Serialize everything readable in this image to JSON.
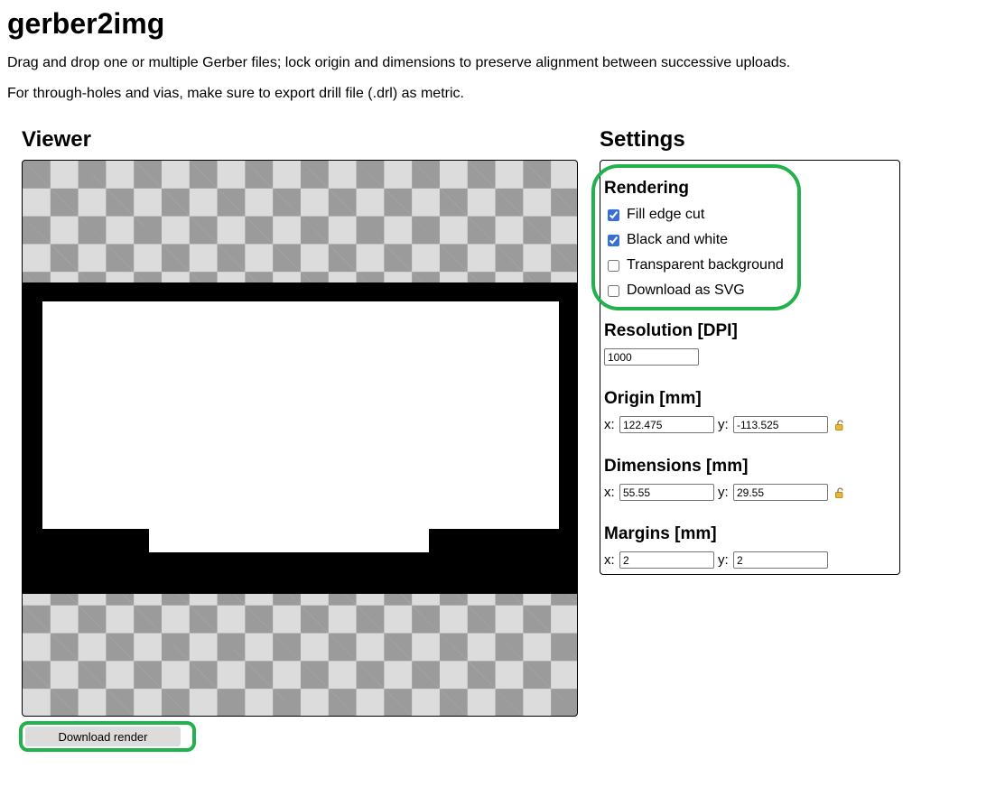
{
  "app": {
    "title": "gerber2img",
    "intro_1": "Drag and drop one or multiple Gerber files; lock origin and dimensions to preserve alignment between successive uploads.",
    "intro_2": "For through-holes and vias, make sure to export drill file (.drl) as metric."
  },
  "viewer": {
    "title": "Viewer",
    "download_label": "Download render"
  },
  "settings": {
    "title": "Settings",
    "rendering": {
      "title": "Rendering",
      "options": [
        {
          "label": "Fill edge cut",
          "checked": true
        },
        {
          "label": "Black and white",
          "checked": true
        },
        {
          "label": "Transparent background",
          "checked": false
        },
        {
          "label": "Download as SVG",
          "checked": false
        }
      ]
    },
    "resolution": {
      "title": "Resolution [DPI]",
      "value": "1000"
    },
    "origin": {
      "title": "Origin [mm]",
      "x_label": "x:",
      "x": "122.475",
      "y_label": "y:",
      "y": "-113.525",
      "lock_icon": "lock-icon"
    },
    "dimensions": {
      "title": "Dimensions [mm]",
      "x_label": "x:",
      "x": "55.55",
      "y_label": "y:",
      "y": "29.55",
      "lock_icon": "lock-icon"
    },
    "margins": {
      "title": "Margins [mm]",
      "x_label": "x:",
      "x": "2",
      "y_label": "y:",
      "y": "2"
    }
  },
  "colors": {
    "highlight": "#22b14c",
    "checkbox_accent": "#3a6fd8"
  }
}
